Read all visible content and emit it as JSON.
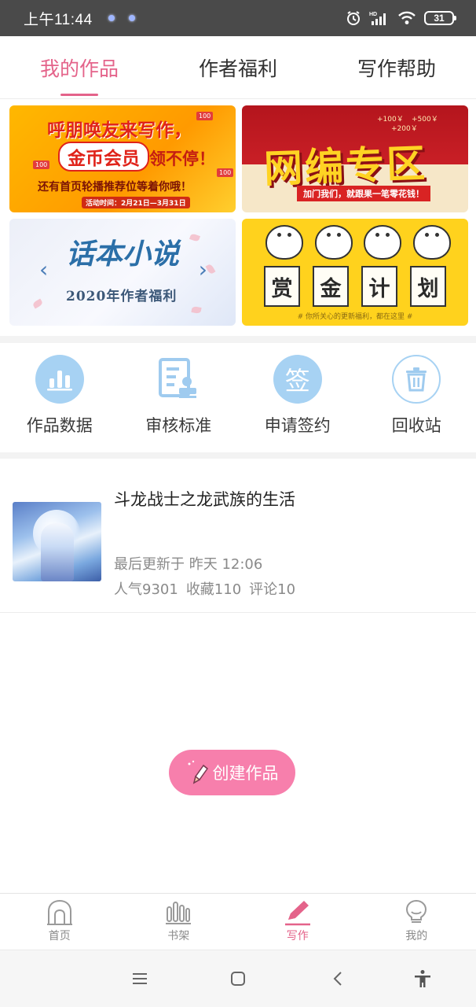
{
  "status_bar": {
    "time": "上午11:44",
    "battery": "31"
  },
  "tabs": [
    {
      "label": "我的作品",
      "active": true
    },
    {
      "label": "作者福利",
      "active": false
    },
    {
      "label": "写作帮助",
      "active": false
    }
  ],
  "banners": {
    "b1": {
      "line1": "呼朋唤友来写作，",
      "coin": "金币会员",
      "line2_tail": "领不停！",
      "line3": "还有首页轮播推荐位等着你哦！",
      "date": "活动时间：2月21日—3月31日",
      "tag": "100"
    },
    "b2": {
      "title": "网编专区",
      "sub": "加门我们，就跟果一笔零花钱！",
      "m1": "+100￥",
      "m2": "+500￥",
      "m3": "+200￥"
    },
    "b3": {
      "title": "话本小说",
      "sub": "2020年作者福利",
      "left": "‹",
      "right": "›"
    },
    "b4": {
      "chars": [
        "赏",
        "金",
        "计",
        "划"
      ],
      "foot": "# 你所关心的更新福利，都在这里 #"
    }
  },
  "tools": [
    {
      "label": "作品数据",
      "icon": "bar-chart-icon"
    },
    {
      "label": "审核标准",
      "icon": "review-document-icon"
    },
    {
      "label": "申请签约",
      "icon": "sign-contract-icon",
      "glyph": "签"
    },
    {
      "label": "回收站",
      "icon": "trash-bin-icon"
    }
  ],
  "work": {
    "title": "斗龙战士之龙武族的生活",
    "updated": "最后更新于 昨天 12:06",
    "popularity": "人气9301",
    "favorites": "收藏110",
    "comments": "评论10"
  },
  "create_button": {
    "label": "创建作品"
  },
  "bottom_nav": [
    {
      "label": "首页",
      "icon": "home-icon",
      "active": false
    },
    {
      "label": "书架",
      "icon": "bookshelf-icon",
      "active": false
    },
    {
      "label": "写作",
      "icon": "pencil-icon",
      "active": true
    },
    {
      "label": "我的",
      "icon": "profile-icon",
      "active": false
    }
  ],
  "colors": {
    "accent": "#e4638a",
    "create_button": "#f77fac",
    "tool_icon": "#a7d2f3"
  }
}
